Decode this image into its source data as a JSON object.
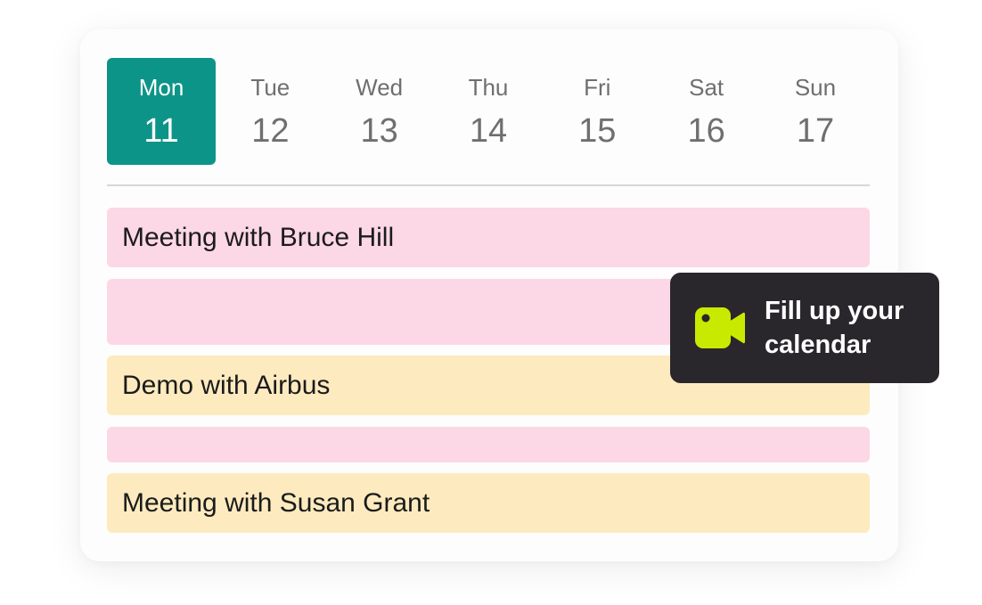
{
  "week": {
    "days": [
      {
        "name": "Mon",
        "num": "11",
        "active": true
      },
      {
        "name": "Tue",
        "num": "12",
        "active": false
      },
      {
        "name": "Wed",
        "num": "13",
        "active": false
      },
      {
        "name": "Thu",
        "num": "14",
        "active": false
      },
      {
        "name": "Fri",
        "num": "15",
        "active": false
      },
      {
        "name": "Sat",
        "num": "16",
        "active": false
      },
      {
        "name": "Sun",
        "num": "17",
        "active": false
      }
    ]
  },
  "events": [
    {
      "title": "Meeting with Bruce Hill",
      "color": "pink"
    },
    {
      "title": "",
      "color": "pink"
    },
    {
      "title": "Demo with Airbus",
      "color": "yellow"
    },
    {
      "title": "",
      "color": "pink"
    },
    {
      "title": "Meeting with Susan Grant",
      "color": "yellow"
    }
  ],
  "toast": {
    "icon": "video-camera-icon",
    "text": "Fill up your calendar"
  },
  "colors": {
    "accent": "#0d9488",
    "pink_event": "#fcd7e6",
    "yellow_event": "#fdebbf",
    "toast_bg": "#29272b",
    "icon_color": "#c8ea00"
  }
}
